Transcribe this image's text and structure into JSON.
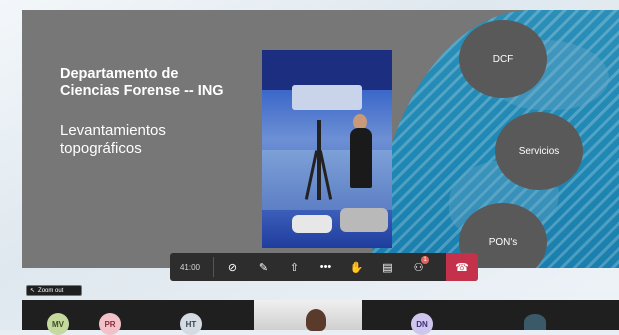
{
  "slide": {
    "title_line1": "Departamento de",
    "title_line2": "Ciencias Forense -- ING",
    "subtitle_line1": "Levantamientos",
    "subtitle_line2": "topográficos",
    "circles": [
      "DCF",
      "Servicios",
      "PON's"
    ]
  },
  "toolbar": {
    "time": "41:00",
    "buttons": [
      {
        "name": "camera-off-icon",
        "glyph": "⊘"
      },
      {
        "name": "mic-off-icon",
        "glyph": "✎"
      },
      {
        "name": "share-screen-icon",
        "glyph": "⇧"
      },
      {
        "name": "more-options-icon",
        "glyph": "•••"
      },
      {
        "name": "raise-hand-icon",
        "glyph": "✋"
      },
      {
        "name": "chat-icon",
        "glyph": "▤"
      },
      {
        "name": "participants-icon",
        "glyph": "⚇"
      }
    ],
    "participants_badge": "1",
    "hangup_glyph": "☎"
  },
  "zoom_out": {
    "icon": "↖",
    "label": "Zoom out"
  },
  "participants": [
    "MV",
    "PR",
    "HT",
    "DN"
  ],
  "colors": {
    "accent": "#c4314b",
    "map": "#1f88b4"
  }
}
